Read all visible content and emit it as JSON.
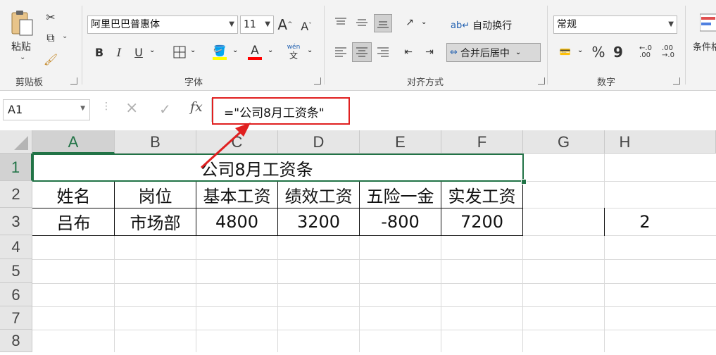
{
  "ribbon": {
    "clipboard": {
      "paste_label": "粘贴",
      "group_label": "剪贴板"
    },
    "font": {
      "font_name": "阿里巴巴普惠体",
      "font_size": "11",
      "bold": "B",
      "italic": "I",
      "underline": "U",
      "font_color_glyph": "A",
      "phonetic_glyph": "wén",
      "phonetic_sub": "文",
      "group_label": "字体",
      "increase_font": "A",
      "decrease_font": "A"
    },
    "alignment": {
      "wrap_text_label": "自动换行",
      "merge_center_label": "合并后居中",
      "group_label": "对齐方式"
    },
    "number": {
      "format_value": "常规",
      "percent": "%",
      "comma": "9",
      "group_label": "数字"
    },
    "styles": {
      "conditional_label": "条件格"
    },
    "colors": {
      "accent_green": "#217346",
      "highlight_yellow": "#ffff00",
      "font_red": "#ff0000",
      "callout_red": "#e02020"
    }
  },
  "formula_bar": {
    "name_box": "A1",
    "cancel": "×",
    "enter": "✓",
    "fx": "fx",
    "formula": "=\"公司8月工资条\""
  },
  "sheet": {
    "columns": [
      "A",
      "B",
      "C",
      "D",
      "E",
      "F",
      "G",
      "H"
    ],
    "rows": [
      "1",
      "2",
      "3",
      "4",
      "5",
      "6",
      "7",
      "8"
    ],
    "title": "公司8月工资条",
    "headers": [
      "姓名",
      "岗位",
      "基本工资",
      "绩效工资",
      "五险一金",
      "实发工资"
    ],
    "data_row": [
      "吕布",
      "市场部",
      "4800",
      "3200",
      "-800",
      "7200"
    ],
    "h3": "2"
  }
}
